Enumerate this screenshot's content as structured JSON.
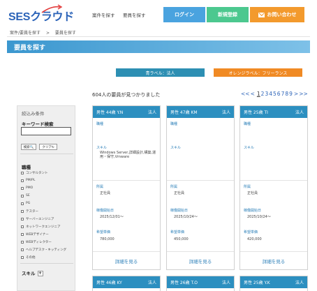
{
  "header": {
    "logo_ses": "SES",
    "logo_rest": "クラウド",
    "nav": [
      "案件を探す",
      "要員を探す"
    ],
    "login": "ログイン",
    "register": "新規登録",
    "contact": "お問い合わせ"
  },
  "breadcrumb": [
    "案件/要員を探す",
    ">",
    "要員を探す"
  ],
  "page_title": "要員を探す",
  "labels": {
    "blue": "青ラベル：法人",
    "orange": "オレンジラベル：フリーランス"
  },
  "result_count": "604人の要員が見つかりました",
  "pager": {
    "prev": "<<",
    "prev1": "<",
    "pages": [
      "1",
      "2",
      "3",
      "4",
      "5",
      "6",
      "7",
      "8",
      "9"
    ],
    "next1": ">",
    "next": ">>"
  },
  "sidebar": {
    "title": "絞込み条件",
    "keyword_label": "キーワード検索",
    "keyword_value": "",
    "search_btn": "検索🔍",
    "clear_btn": "クリア↻",
    "job_label": "職種",
    "jobs": [
      "コンサルタント",
      "PM/PL",
      "PMO",
      "SE",
      "PG",
      "テスター",
      "サーバーエンジニア",
      "ネットワークエンジニア",
      "WEBデザイナー",
      "WEBディレクター",
      "ヘルプデスク・キッティング",
      "その他"
    ],
    "skill_label": "スキル",
    "skill_plus": "+"
  },
  "card_labels": {
    "job": "職種",
    "skill": "スキル",
    "affiliation": "所属",
    "start": "稼働開始日",
    "price": "希望単価",
    "detail": "詳細を見る"
  },
  "cards": [
    {
      "head": "男性 44歳 Y.N",
      "type": "法人",
      "job": "",
      "skill": "Windows Server,詳細設計,構築,運用・保守,Vmware",
      "affiliation": "正社員",
      "start": "2025/12/01〜",
      "price": "780,000"
    },
    {
      "head": "男性 47歳 KM",
      "type": "法人",
      "job": "",
      "skill": "",
      "affiliation": "正社員",
      "start": "2025/10/24〜",
      "price": "450,000"
    },
    {
      "head": "男性 25歳 TI",
      "type": "法人",
      "job": "",
      "skill": "",
      "affiliation": "正社員",
      "start": "2025/10/24〜",
      "price": "420,000"
    }
  ],
  "cards_row2": [
    {
      "head": "男性 46歳 KY",
      "type": "法人"
    },
    {
      "head": "男性 26歳 T.O",
      "type": "法人"
    },
    {
      "head": "男性 25歳 Y.K",
      "type": "法人"
    }
  ],
  "colors": {
    "accent": "#2c8fc0",
    "login": "#4aa3df",
    "register": "#4cc88f",
    "contact": "#f39a2d"
  }
}
